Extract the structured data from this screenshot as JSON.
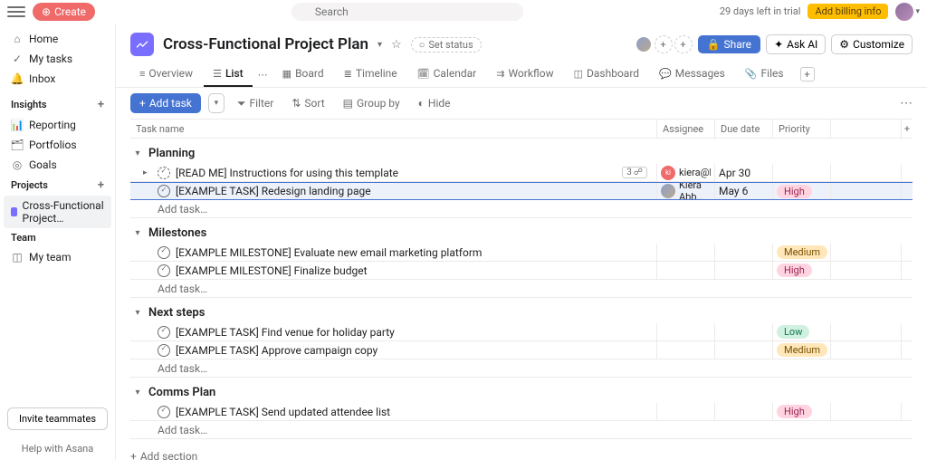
{
  "topbar": {
    "create_label": "Create",
    "search_placeholder": "Search",
    "trial_text": "29 days left in trial",
    "billing_label": "Add billing info"
  },
  "sidebar": {
    "home": "Home",
    "my_tasks": "My tasks",
    "inbox": "Inbox",
    "insights_heading": "Insights",
    "reporting": "Reporting",
    "portfolios": "Portfolios",
    "goals": "Goals",
    "projects_heading": "Projects",
    "project_item": "Cross-Functional Project…",
    "team_heading": "Team",
    "my_team": "My team",
    "invite_label": "Invite teammates",
    "help_label": "Help with Asana"
  },
  "project": {
    "title": "Cross-Functional Project Plan",
    "set_status": "Set status",
    "share_label": "Share",
    "ask_ai_label": "Ask AI",
    "customize_label": "Customize"
  },
  "tabs": {
    "overview": "Overview",
    "list": "List",
    "board": "Board",
    "timeline": "Timeline",
    "calendar": "Calendar",
    "workflow": "Workflow",
    "dashboard": "Dashboard",
    "messages": "Messages",
    "files": "Files"
  },
  "toolbar": {
    "add_task": "Add task",
    "filter": "Filter",
    "sort": "Sort",
    "group_by": "Group by",
    "hide": "Hide"
  },
  "columns": {
    "task_name": "Task name",
    "assignee": "Assignee",
    "due_date": "Due date",
    "priority": "Priority"
  },
  "sections": {
    "planning": "Planning",
    "milestones": "Milestones",
    "next_steps": "Next steps",
    "comms_plan": "Comms Plan"
  },
  "tasks": {
    "planning_0_name": "[READ ME] Instructions for using this template",
    "planning_0_subtasks": "3",
    "planning_0_assignee": "kiera@kiera…",
    "planning_0_assignee_initials": "ki",
    "planning_0_due": "Apr 30",
    "planning_1_name": "[EXAMPLE TASK] Redesign landing page",
    "planning_1_assignee": "Kiera Abb…",
    "planning_1_due": "May 6",
    "planning_1_priority": "High",
    "milestones_0_name": "[EXAMPLE MILESTONE] Evaluate new email marketing platform",
    "milestones_0_priority": "Medium",
    "milestones_1_name": "[EXAMPLE MILESTONE] Finalize budget",
    "milestones_1_priority": "High",
    "nextsteps_0_name": "[EXAMPLE TASK] Find venue for holiday party",
    "nextsteps_0_priority": "Low",
    "nextsteps_1_name": "[EXAMPLE TASK] Approve campaign copy",
    "nextsteps_1_priority": "Medium",
    "comms_0_name": "[EXAMPLE TASK] Send updated attendee list",
    "comms_0_priority": "High"
  },
  "add_task_row": "Add task…",
  "add_section": "Add section"
}
